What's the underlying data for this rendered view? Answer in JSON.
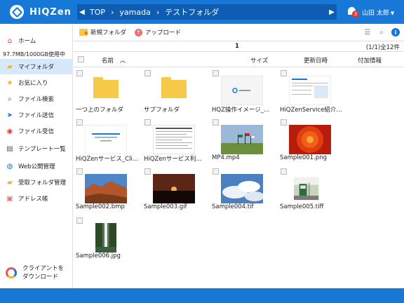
{
  "header": {
    "logo_text": "HiQZen",
    "breadcrumb": [
      "TOP",
      "yamada",
      "テストフォルダ"
    ],
    "notification_count": "3",
    "user_name": "山田 太郎"
  },
  "sidebar": {
    "home_label": "ホーム",
    "storage_text": "97.7MB/1000GB使用中",
    "items": [
      {
        "label": "マイフォルダ",
        "icon": "my-folder-icon"
      },
      {
        "label": "お気に入り",
        "icon": "star-icon"
      },
      {
        "label": "ファイル検索",
        "icon": "search-icon"
      },
      {
        "label": "ファイル送信",
        "icon": "send-icon"
      },
      {
        "label": "ファイル受信",
        "icon": "receive-icon"
      },
      {
        "label": "テンプレート一覧",
        "icon": "template-icon"
      },
      {
        "label": "Web公開管理",
        "icon": "globe-icon"
      },
      {
        "label": "受取フォルダ管理",
        "icon": "inbox-folder-icon"
      },
      {
        "label": "アドレス帳",
        "icon": "address-book-icon"
      }
    ],
    "client_download": [
      "クライアントを",
      "ダウンロード"
    ]
  },
  "toolbar": {
    "new_folder_label": "新規フォルダ",
    "upload_label": "アップロード"
  },
  "pager": {
    "current_page": "1",
    "summary": "(1/1)全12件"
  },
  "columns": {
    "name": "名前",
    "name_sort": "︿",
    "size": "サイズ",
    "updated": "更新日時",
    "extra": "付加情報"
  },
  "files": [
    {
      "name": "一つ上のフォルダ",
      "kind": "folder"
    },
    {
      "name": "サブフォルダ",
      "kind": "folder"
    },
    {
      "name": "HQZ操作イメージ_…",
      "kind": "doc"
    },
    {
      "name": "HiQZenService紹介…",
      "kind": "doc2"
    },
    {
      "name": "HiQZenサービス_Cli…",
      "kind": "doc3"
    },
    {
      "name": "HiQZenサービス利用…",
      "kind": "doc4"
    },
    {
      "name": "MP4.mp4",
      "kind": "video"
    },
    {
      "name": "Sample001.png",
      "kind": "flower"
    },
    {
      "name": "Sample002.bmp",
      "kind": "canyon"
    },
    {
      "name": "Sample003.gif",
      "kind": "sunset"
    },
    {
      "name": "Sample004.tif",
      "kind": "sky"
    },
    {
      "name": "Sample005.tiff",
      "kind": "train"
    },
    {
      "name": "Sample006.jpg",
      "kind": "waterfall"
    }
  ],
  "colors": {
    "header": "#1878d8",
    "sidebar_active": "#d6e8fb",
    "folder": "#f7c948"
  }
}
